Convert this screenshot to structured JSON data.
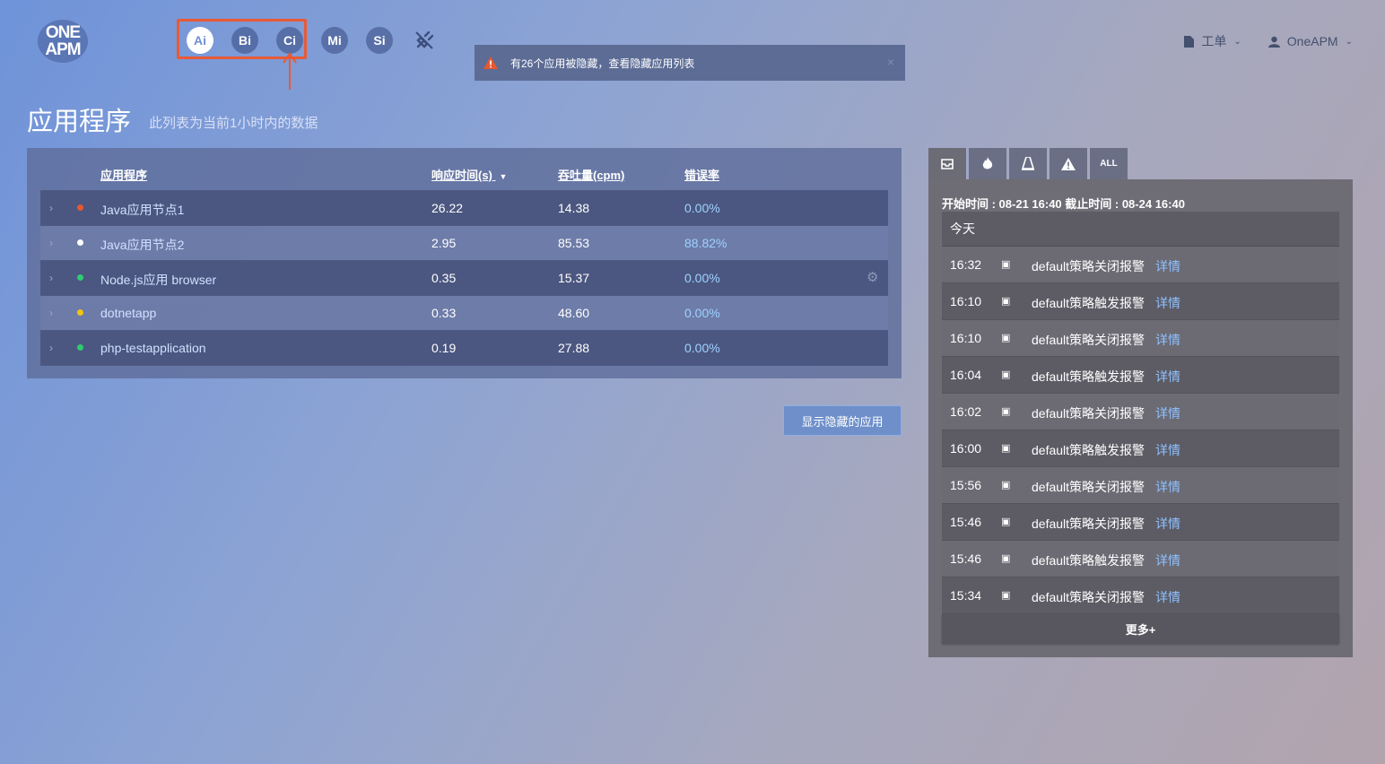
{
  "logo": {
    "line1": "ONE",
    "line2": "APM"
  },
  "products": [
    {
      "label": "Ai",
      "icon": "ai-product-icon",
      "active": true
    },
    {
      "label": "Bi",
      "icon": "bi-product-icon",
      "active": false
    },
    {
      "label": "Ci",
      "icon": "ci-product-icon",
      "active": false
    },
    {
      "label": "Mi",
      "icon": "mi-product-icon",
      "active": false
    },
    {
      "label": "Si",
      "icon": "si-product-icon",
      "active": false
    }
  ],
  "notice": {
    "text": "有26个应用被隐藏，查看隐藏应用列表",
    "close": "×"
  },
  "topright": {
    "ticket": "工单",
    "user": "OneAPM"
  },
  "page": {
    "title": "应用程序",
    "subtitle": "此列表为当前1小时内的数据"
  },
  "table": {
    "headers": {
      "app": "应用程序",
      "response": "响应时间(s)",
      "throughput": "吞吐量(cpm)",
      "error": "错误率"
    },
    "rows": [
      {
        "name": "Java应用节点1",
        "response": "26.22",
        "throughput": "14.38",
        "error": "0.00%",
        "status_color": "#e8572e"
      },
      {
        "name": "Java应用节点2",
        "response": "2.95",
        "throughput": "85.53",
        "error": "88.82%",
        "status_color": "#ffffff"
      },
      {
        "name": "Node.js应用 browser",
        "response": "0.35",
        "throughput": "15.37",
        "error": "0.00%",
        "status_color": "#2ecc71"
      },
      {
        "name": "dotnetapp",
        "response": "0.33",
        "throughput": "48.60",
        "error": "0.00%",
        "status_color": "#f1c40f"
      },
      {
        "name": "php-testapplication",
        "response": "0.19",
        "throughput": "27.88",
        "error": "0.00%",
        "status_color": "#2ecc71"
      }
    ]
  },
  "show_hidden_button": "显示隐藏的应用",
  "alerts": {
    "tabs": [
      "inbox-icon",
      "fire-icon",
      "cone-icon",
      "warning-icon",
      "ALL"
    ],
    "range": "开始时间 : 08-21 16:40 截止时间 : 08-24 16:40",
    "today": "今天",
    "detail_label": "详情",
    "items": [
      {
        "time": "16:32",
        "message": "default策略关闭报警"
      },
      {
        "time": "16:10",
        "message": "default策略触发报警"
      },
      {
        "time": "16:10",
        "message": "default策略关闭报警"
      },
      {
        "time": "16:04",
        "message": "default策略触发报警"
      },
      {
        "time": "16:02",
        "message": "default策略关闭报警"
      },
      {
        "time": "16:00",
        "message": "default策略触发报警"
      },
      {
        "time": "15:56",
        "message": "default策略关闭报警"
      },
      {
        "time": "15:46",
        "message": "default策略关闭报警"
      },
      {
        "time": "15:46",
        "message": "default策略触发报警"
      },
      {
        "time": "15:34",
        "message": "default策略关闭报警"
      }
    ],
    "more": "更多+"
  }
}
